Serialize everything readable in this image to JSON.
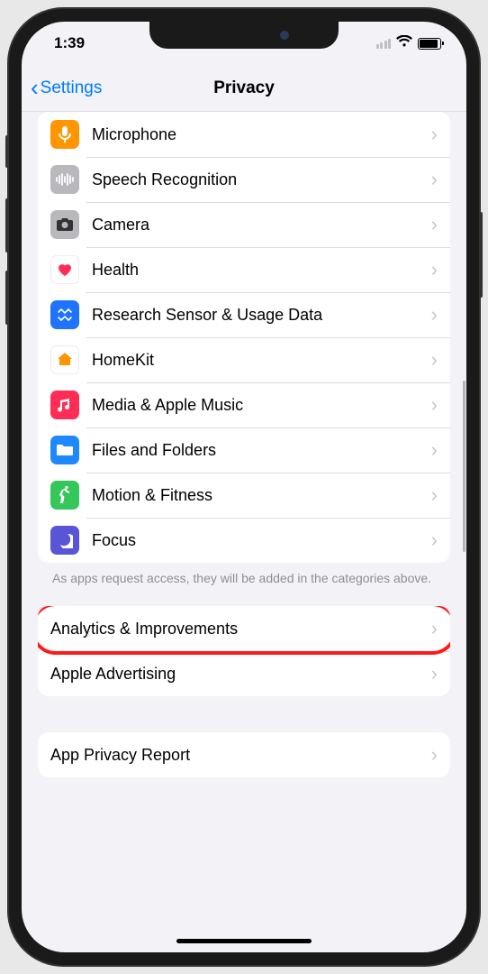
{
  "statusBar": {
    "time": "1:39"
  },
  "nav": {
    "back": "Settings",
    "title": "Privacy"
  },
  "iconColors": {
    "microphone": "#ff9500",
    "speech": "#b8b8bd",
    "camera": "#b8b8bd",
    "health": "#ffffff",
    "research": "#1f74ff",
    "homekit": "#ffffff",
    "music": "#ff2d55",
    "files": "#1e88ff",
    "motion": "#34c759",
    "focus": "#5856d6"
  },
  "group1": [
    {
      "id": "microphone",
      "label": "Microphone"
    },
    {
      "id": "speech",
      "label": "Speech Recognition"
    },
    {
      "id": "camera",
      "label": "Camera"
    },
    {
      "id": "health",
      "label": "Health"
    },
    {
      "id": "research",
      "label": "Research Sensor & Usage Data"
    },
    {
      "id": "homekit",
      "label": "HomeKit"
    },
    {
      "id": "music",
      "label": "Media & Apple Music"
    },
    {
      "id": "files",
      "label": "Files and Folders"
    },
    {
      "id": "motion",
      "label": "Motion & Fitness"
    },
    {
      "id": "focus",
      "label": "Focus"
    }
  ],
  "footer1": "As apps request access, they will be added in the categories above.",
  "group2": [
    {
      "id": "analytics",
      "label": "Analytics & Improvements",
      "highlighted": true
    },
    {
      "id": "advertising",
      "label": "Apple Advertising"
    }
  ],
  "group3": [
    {
      "id": "appprivacy",
      "label": "App Privacy Report"
    }
  ]
}
